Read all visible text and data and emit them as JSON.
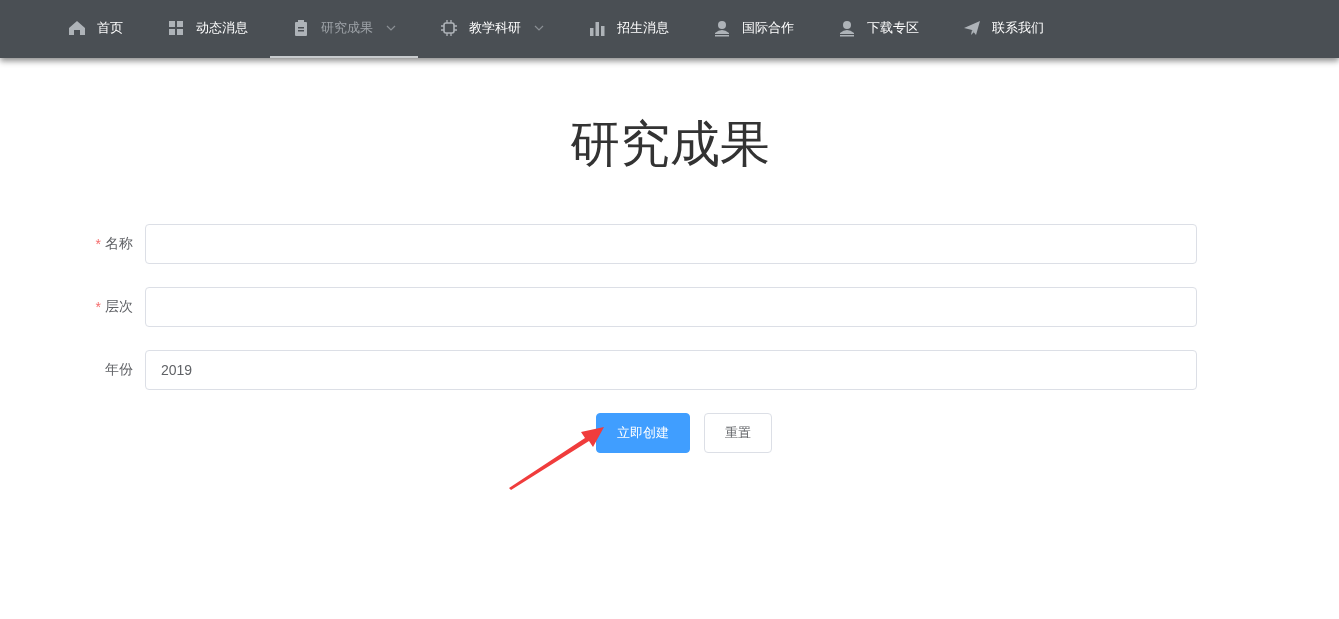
{
  "nav": {
    "items": [
      {
        "label": "首页",
        "selected": false,
        "has_menu": false
      },
      {
        "label": "动态消息",
        "selected": false,
        "has_menu": false
      },
      {
        "label": "研究成果",
        "selected": true,
        "has_menu": true
      },
      {
        "label": "教学科研",
        "selected": false,
        "has_menu": true
      },
      {
        "label": "招生消息",
        "selected": false,
        "has_menu": false
      },
      {
        "label": "国际合作",
        "selected": false,
        "has_menu": false
      },
      {
        "label": "下载专区",
        "selected": false,
        "has_menu": false
      },
      {
        "label": "联系我们",
        "selected": false,
        "has_menu": false
      }
    ]
  },
  "page_title": "研究成果",
  "form": {
    "fields": [
      {
        "required_mark": "*",
        "label": "名称"
      },
      {
        "required_mark": "*",
        "label": "层次"
      },
      {
        "label": "年份",
        "value": "2019"
      }
    ],
    "buttons": [
      {
        "label": "立即创建",
        "kind": "primary"
      },
      {
        "label": "重置",
        "kind": "default"
      }
    ]
  }
}
